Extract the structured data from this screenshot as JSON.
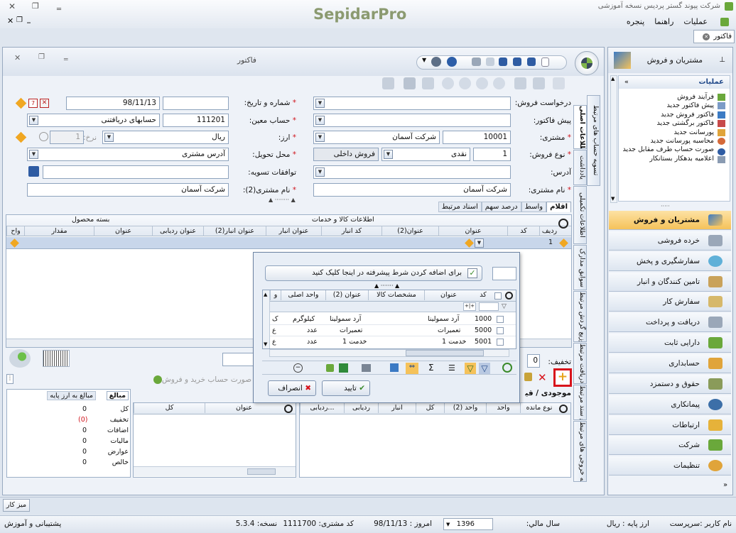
{
  "app": {
    "logo": "SepidarPro",
    "title": "شرکت پیوند گستر پردیس نسخه آموزشی"
  },
  "menu": {
    "items": [
      "عملیات",
      "راهنما",
      "پنجره"
    ]
  },
  "doc_tab": {
    "label": "فاکتور"
  },
  "form_window": {
    "title": "فاکتور"
  },
  "form": {
    "sales_request_label": "درخواست فروش:",
    "date_label": "شماره و تاریخ:",
    "date_value": "98/11/13",
    "pre_invoice_label": "پیش فاکتور:",
    "account_label": "حساب معین:",
    "account_code": "111201",
    "account_name": "حسابهای دریافتنی",
    "customer_label": "مشتری:",
    "customer_code": "10001",
    "customer_name": "شرکت آسمان",
    "currency_label": "ارز:",
    "currency_value": "ریال",
    "rate_label": "نرخ:",
    "rate_value": "1",
    "sale_type_label": "نوع فروش:",
    "sale_type_code": "1",
    "sale_type_name": "نقدی",
    "sale_scope": "فروش داخلی",
    "delivery_label": "محل تحویل:",
    "delivery_value": "آدرس مشتری",
    "address_label": "آدرس:",
    "settlement_label": "توافقات تسویه:",
    "customer_name_label": "نام مشتری:",
    "customer_name_value": "شرکت آسمان",
    "customer2_label": "نام مشتری(2):",
    "customer2_value": "شرکت آسمان",
    "discount_label": "تخفیف:",
    "discount_value": "0"
  },
  "vertical_tabs": [
    "تسویه حساب های مرتبط",
    "اطلاعات اصلی",
    "یادداشت",
    "اطلاعات تکمیلی",
    "سوابق مدارک",
    "توزیع گردش مرتبط",
    "توزیع دریافت مرتبط",
    "توزیع سند مرتبط",
    "حواله خروجی های مرتبط"
  ],
  "items_tabs": [
    "اقلام",
    "واسط",
    "درصد سهم",
    "اسناد مرتبط"
  ],
  "items_grid": {
    "group_goods": "اطلاعات کالا و خدمات",
    "group_package": "بسته محصول",
    "columns": [
      "ردیف",
      "کد",
      "عنوان",
      "عنوان(2)",
      "کد انبار",
      "عنوان انبار",
      "عنوان انبار(2)",
      "عنوان ردیابی",
      "عنوان",
      "مقدار",
      "واح"
    ],
    "row_no": "1"
  },
  "bottom_panel": {
    "tabs": [
      "موجودی / قیمت"
    ],
    "right_cols": [
      "نوع مانده",
      "واحد",
      "واحد (2)",
      "کل",
      "انبار",
      "ردیابی",
      "ردیابی..."
    ],
    "mid_cols": [
      "عنوان",
      "کل"
    ],
    "hint": "صورت حساب خرید و فروش"
  },
  "summary": {
    "tabs": [
      "مبالغ",
      "مبالغ به ارز پایه"
    ],
    "rows": [
      {
        "label": "کل",
        "value": "0"
      },
      {
        "label": "تخفیف",
        "value": "(0)"
      },
      {
        "label": "اضافات",
        "value": "0"
      },
      {
        "label": "مالیات",
        "value": "0"
      },
      {
        "label": "عوارض",
        "value": "0"
      },
      {
        "label": "خالص",
        "value": "0"
      }
    ]
  },
  "lookup": {
    "filter_hint": "برای اضافه کردن شرط پیشرفته در اینجا کلیک کنید",
    "columns": [
      "کد",
      "عنوان",
      "مشخصات کالا",
      "عنوان (2)",
      "واحد اصلی",
      "و"
    ],
    "rows": [
      {
        "code": "1000",
        "title": "آرد سمولینا",
        "title2": "آرد سمولینا",
        "unit": "کیلوگرم",
        "u": "ک"
      },
      {
        "code": "5000",
        "title": "تعمیرات",
        "title2": "تعمیرات",
        "unit": "عدد",
        "u": "ع"
      },
      {
        "code": "5001",
        "title": "خدمت 1",
        "title2": "خدمت 1",
        "unit": "عدد",
        "u": "ع"
      }
    ],
    "ok": "تایید",
    "cancel": "انصراف"
  },
  "sidebar": {
    "header": "مشتریان و فروش",
    "ops_title": "عملیات",
    "ops": [
      "فرآیند فروش",
      "پیش فاکتور جدید",
      "فاکتور فروش جدید",
      "فاکتور برگشتی جدید",
      "پورسانت جدید",
      "محاسبه پورسانت جدید",
      "صورت حساب طرف مقابل جدید",
      "اعلامیه بدهکار بستانکار"
    ],
    "nav": [
      "مشتریان و فروش",
      "خرده فروشی",
      "سفارشگیری و پخش",
      "تامین کنندگان و انبار",
      "سفارش کار",
      "دریافت و پرداخت",
      "دارایی ثابت",
      "حسابداری",
      "حقوق و دستمزد",
      "پیمانکاری",
      "ارتباطات",
      "شرکت",
      "تنظیمات"
    ]
  },
  "taskbar": {
    "desk": "میز کار"
  },
  "status": {
    "user": "نام کاربر :سرپرست",
    "base_currency": "ارز پایه :  ریال",
    "fiscal_year_label": "سال مالي:",
    "fiscal_year": "1396",
    "today": "امروز :  98/11/13",
    "customer_code": "کد مشتری:  1111700",
    "version": "نسخه:  5.3.4",
    "support": "پشتیبانی و آموزش"
  },
  "colors": {
    "accent": "#f0b23c",
    "highlight": "#d8131b",
    "grid_selection": "#c8d6ea",
    "nav_active": "#f5c25a"
  }
}
